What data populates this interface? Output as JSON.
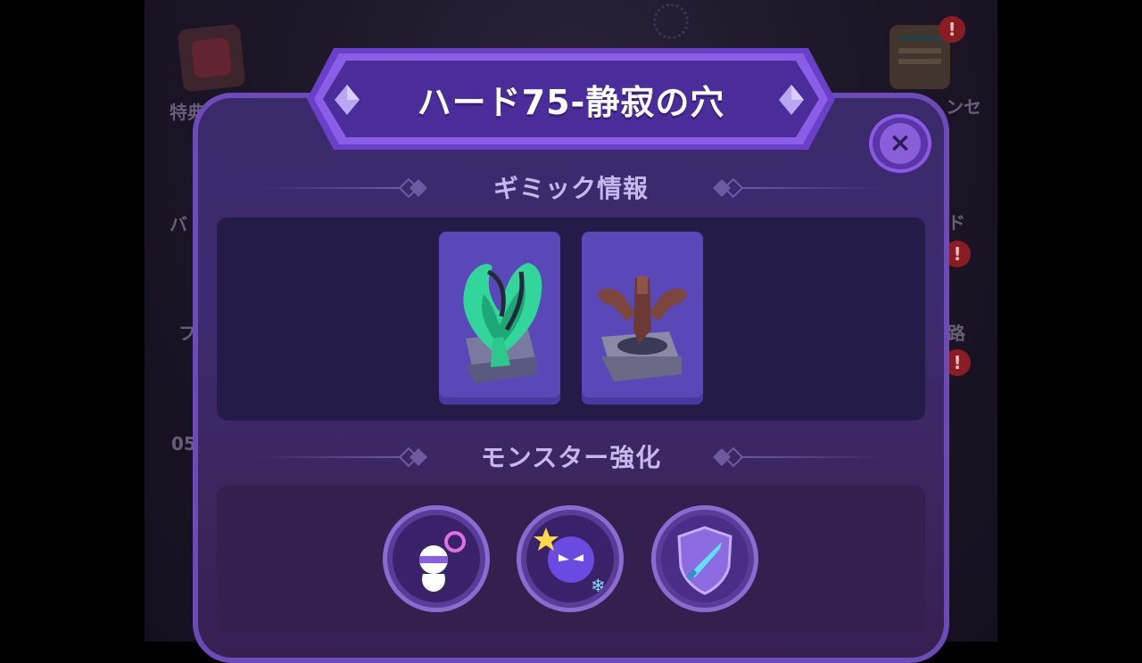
{
  "dialog": {
    "title": "ハード75-静寂の穴",
    "close_icon": "×"
  },
  "sections": {
    "gimmick_title": "ギミック情報",
    "monster_title": "モンスター強化"
  },
  "gimmicks": [
    {
      "icon": "green-crystal-flame-icon"
    },
    {
      "icon": "brown-trident-totem-icon"
    }
  ],
  "monster_buffs": [
    {
      "icon": "mummy-revive-icon"
    },
    {
      "icon": "dark-spirit-freeze-icon"
    },
    {
      "icon": "shield-sword-icon"
    }
  ],
  "background": {
    "left_label_1": "特典",
    "left_label_2": "バ",
    "left_label_3": "フ",
    "left_label_4": "05",
    "right_label_1": "ンセ",
    "right_label_2": "ド",
    "right_label_3": "路",
    "badge_text": "!"
  },
  "colors": {
    "modal_border": "#6c4bb8",
    "modal_body": "#3a2a6c",
    "title_text": "#ffffff",
    "section_text": "#c6b8ec",
    "card_bg": "#5a47b8"
  }
}
